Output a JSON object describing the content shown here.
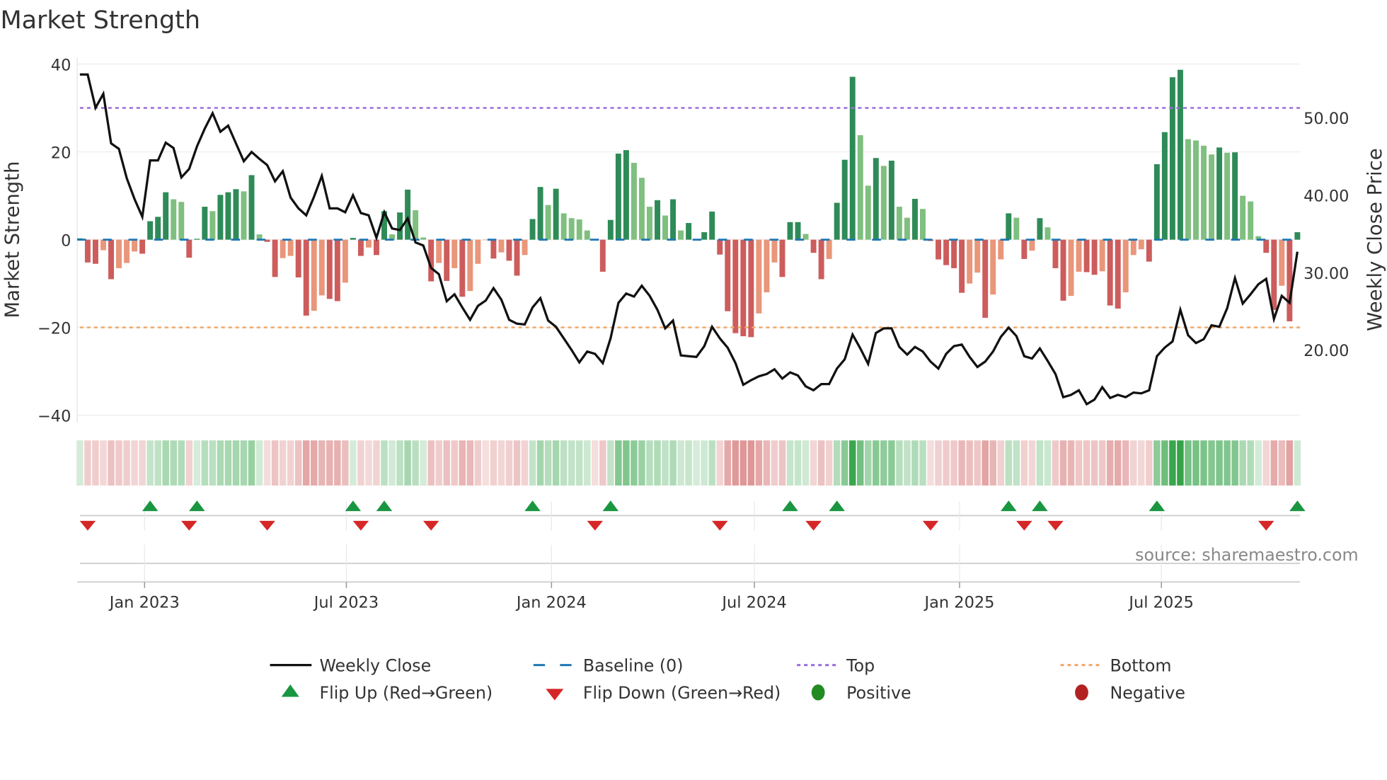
{
  "chart_data": {
    "type": "bar",
    "title": "Market Strength",
    "ylabel": "Market Strength",
    "y2label": "Weekly Close Price",
    "ylim": [
      -41.7,
      41.5
    ],
    "y2lim": [
      10.6,
      57.8
    ],
    "yticks": [
      40,
      20,
      0,
      -20,
      -40
    ],
    "ytick_labels": [
      "40",
      "20",
      "0",
      "−20",
      "−40"
    ],
    "y2ticks": [
      50,
      40,
      30,
      20
    ],
    "y2tick_labels": [
      "50.00",
      "40.00",
      "30.00",
      "20.00"
    ],
    "x_start_date": "2022-11-04",
    "x_step_days": 7,
    "xticks": [
      "2023-01-01",
      "2023-07-01",
      "2024-01-01",
      "2024-07-01",
      "2025-01-01",
      "2025-07-01"
    ],
    "xtick_labels": [
      "Jan 2023",
      "Jul 2023",
      "Jan 2024",
      "Jul 2024",
      "Jan 2025",
      "Jul 2025"
    ],
    "top_level": 30,
    "bottom_level": -20,
    "baseline": 0,
    "grid": true,
    "legend_position": "bottom",
    "strength": [
      0.3,
      -5.2,
      -5.5,
      -2.4,
      -9,
      -6.5,
      -5.3,
      -2.7,
      -3.2,
      4.2,
      5.2,
      10.8,
      9.2,
      8.6,
      -4.1,
      0.2,
      7.5,
      6.5,
      10.2,
      10.8,
      11.5,
      11,
      14.7,
      1.2,
      -0.5,
      -8.5,
      -4.2,
      -3.7,
      -8.6,
      -17.3,
      -16.2,
      -12.7,
      -13.5,
      -14,
      -9.8,
      0.4,
      -3.7,
      -1.8,
      -3.5,
      6.5,
      1.2,
      6.2,
      11.4,
      6.7,
      0.5,
      -9.5,
      -5.3,
      -9.4,
      -6.5,
      -13,
      -11.7,
      -5.5,
      -0.1,
      -4.3,
      -2.9,
      -4.8,
      -8.2,
      -3.5,
      4.7,
      12,
      7.9,
      11.6,
      6,
      4.9,
      4.6,
      2.1,
      -0.2,
      -7.3,
      4.5,
      19.6,
      20.4,
      17.5,
      14.1,
      7.5,
      9,
      5.5,
      9.2,
      2.1,
      3.8,
      0.1,
      1.7,
      6.4,
      -3.4,
      -16.3,
      -21.3,
      -22,
      -22.2,
      -16.8,
      -12,
      -5.2,
      -8.5,
      4,
      4,
      1.3,
      -3,
      -9,
      -4.4,
      8.4,
      18.2,
      37.1,
      23.8,
      12.3,
      18.6,
      16.8,
      18,
      7.5,
      5,
      9.3,
      7,
      -0.3,
      -4.5,
      -5.8,
      -6.5,
      -12.1,
      -10,
      -7.5,
      -17.8,
      -12.5,
      -4.5,
      6,
      5,
      -4.4,
      -2.5,
      4.9,
      2.8,
      -6.5,
      -13.9,
      -12.8,
      -7.3,
      -7.4,
      -8,
      -7.2,
      -15,
      -15.7,
      -12,
      -3.5,
      -2.2,
      -5,
      17.2,
      24.5,
      37,
      38.7,
      22.9,
      22.6,
      21.4,
      19.4,
      21,
      19.8,
      19.9,
      10,
      8.7,
      0.8,
      -3,
      -16,
      -10.5,
      -18.6,
      1.7
    ],
    "weekly_close": [
      55.6,
      55.6,
      51.3,
      53.1,
      46.7,
      46.0,
      42.2,
      39.5,
      37.2,
      44.5,
      44.5,
      46.8,
      46.1,
      42.3,
      43.4,
      46.3,
      48.6,
      50.6,
      48.2,
      49.0,
      46.7,
      44.4,
      45.6,
      44.7,
      43.9,
      41.8,
      43.1,
      39.7,
      38.3,
      37.4,
      39.8,
      42.5,
      38.3,
      38.3,
      37.8,
      40.0,
      37.7,
      37.4,
      34.5,
      37.8,
      35.7,
      35.5,
      37.0,
      33.9,
      33.5,
      30.6,
      29.8,
      26.3,
      27.2,
      25.5,
      23.9,
      25.7,
      26.4,
      28.0,
      26.5,
      23.9,
      23.4,
      23.3,
      25.5,
      26.7,
      23.8,
      23.0,
      21.5,
      20.0,
      18.4,
      19.8,
      19.5,
      18.3,
      21.5,
      26.1,
      27.3,
      26.9,
      28.3,
      27.0,
      25.2,
      22.8,
      23.8,
      19.3,
      19.2,
      19.1,
      20.5,
      23.0,
      21.5,
      20.3,
      18.3,
      15.5,
      16.1,
      16.6,
      16.9,
      17.5,
      16.3,
      17.1,
      16.7,
      15.3,
      14.8,
      15.6,
      15.6,
      17.6,
      18.8,
      22.0,
      20.2,
      18.2,
      22.2,
      22.8,
      22.8,
      20.4,
      19.4,
      20.4,
      19.8,
      18.5,
      17.6,
      19.5,
      20.5,
      20.7,
      19.1,
      17.8,
      18.5,
      19.8,
      21.7,
      22.9,
      21.8,
      19.2,
      18.9,
      20.2,
      18.6,
      16.9,
      13.9,
      14.2,
      14.8,
      13.0,
      13.6,
      15.2,
      13.8,
      14.2,
      13.9,
      14.5,
      14.4,
      14.8,
      19.2,
      20.3,
      21.1,
      25.2,
      21.9,
      20.9,
      21.4,
      23.2,
      23.0,
      25.4,
      29.3,
      26.0,
      27.2,
      28.5,
      29.2,
      24.0,
      27.0,
      26.1,
      32.7
    ],
    "legend": [
      {
        "label": "Weekly Close",
        "kind": "line"
      },
      {
        "label": "Baseline (0)",
        "kind": "dash"
      },
      {
        "label": "Top",
        "kind": "dot-purple"
      },
      {
        "label": "Bottom",
        "kind": "dot-orange"
      },
      {
        "label": "Flip Up (Red→Green)",
        "kind": "triangle-up"
      },
      {
        "label": "Flip Down (Green→Red)",
        "kind": "triangle-down"
      },
      {
        "label": "Positive",
        "kind": "circle-green"
      },
      {
        "label": "Negative",
        "kind": "circle-red"
      }
    ],
    "source": "source: sharemaestro.com",
    "colors": {
      "pos_dark": "#2e8b57",
      "pos_light": "#7fbf7f",
      "neg_dark": "#cd5c5c",
      "neg_light": "#e9967a",
      "line": "#111111",
      "baseline": "#1f77b4",
      "top": "#9b6ddb",
      "bottom": "#f0a868",
      "flip_up": "#1a9641",
      "flip_down": "#d62728",
      "positive": "#228b22",
      "negative": "#b22222"
    }
  }
}
